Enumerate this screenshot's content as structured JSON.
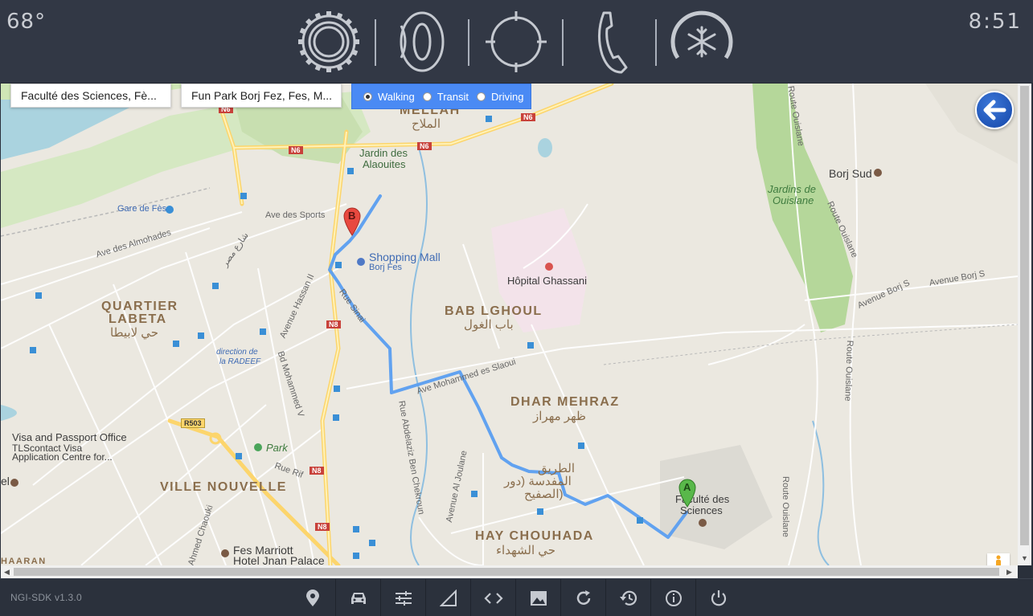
{
  "status": {
    "temperature": "68°",
    "time": "8:51"
  },
  "top_icons": [
    {
      "name": "settings-gear-icon"
    },
    {
      "name": "media-speaker-icon"
    },
    {
      "name": "navigation-compass-icon"
    },
    {
      "name": "phone-icon"
    },
    {
      "name": "climate-fan-icon"
    }
  ],
  "route": {
    "origin": "Faculté des Sciences, Fè...",
    "destination": "Fun Park Borj Fez, Fes, M...",
    "modes": [
      {
        "label": "Walking",
        "selected": true
      },
      {
        "label": "Transit",
        "selected": false
      },
      {
        "label": "Driving",
        "selected": false
      }
    ],
    "marker_a": "A",
    "marker_b": "B"
  },
  "map_labels": {
    "mellah": "MELLAH",
    "mellah_ar": "الملاح",
    "jardin_alaouites_1": "Jardin des",
    "jardin_alaouites_2": "Alaouites",
    "gare": "Gare de Fès",
    "ave_sports": "Ave des Sports",
    "ave_almohades": "Ave des Almohades",
    "shopping_mall": "Shopping Mall",
    "borj_fes": "Borj Fes",
    "hopital": "Hôpital Ghassani",
    "bab_lghoul": "BAB LGHOUL",
    "bab_lghoul_ar": "باب الغول",
    "quartier_1": "QUARTIER",
    "quartier_2": "LABETA",
    "quartier_ar": "حي لابيطا",
    "direction_1": "direction de",
    "direction_2": "la RADEEF",
    "avenue_hassan": "Avenue Hassan II",
    "rue_sinai": "Rue Sinai",
    "bd_mohammed": "Bd Mohammed V",
    "ave_slaoui": "Ave Mohammed es Slaoui",
    "dhar_mehraz": "DHAR MEHRAZ",
    "dhar_mehraz_ar": "ظهر مهراز",
    "rue_abdelaziz": "Rue Abdelaziz Ben Chekroun",
    "avenue_joulane": "Avenue Al Joulane",
    "tariq_1": "الطريق",
    "tariq_2": "المفدسة (دور",
    "tariq_3": "الصفيح)",
    "faculte_1": "Faculté des",
    "faculte_2": "Sciences",
    "hay_chouhada": "HAY CHOUHADA",
    "hay_chouhada_ar": "حي الشهداء",
    "visa_1": "Visa and Passport Office",
    "visa_2": "TLScontact Visa",
    "visa_3": "Application Centre for...",
    "park": "Park",
    "rue_rif": "Rue Rif",
    "ville_nouvelle": "VILLE NOUVELLE",
    "ahmed_chaouki": "Ahmed Chaouki",
    "fes_marriott_1": "Fes Marriott",
    "fes_marriott_2": "Hotel Jnan Palace",
    "borj_sud": "Borj Sud",
    "jardins_ouislane_1": "Jardins de",
    "jardins_ouislane_2": "Ouislane",
    "route_ouislane": "Route Ouislane",
    "avenue_borj": "Avenue Borj S",
    "avenue_borj_2": "Avenue Borj S",
    "sare_misr": "شارع مصر",
    "el_partial": "el",
    "ihaaran": "HAARAN",
    "n6": "N6",
    "n8": "N8",
    "r503": "R503"
  },
  "bottom": {
    "sdk_version": "NGI-SDK v1.3.0",
    "buttons": [
      {
        "name": "location-pin-icon"
      },
      {
        "name": "car-icon"
      },
      {
        "name": "sliders-icon"
      },
      {
        "name": "signal-icon"
      },
      {
        "name": "code-icon"
      },
      {
        "name": "image-icon"
      },
      {
        "name": "refresh-icon"
      },
      {
        "name": "history-icon"
      },
      {
        "name": "info-icon"
      },
      {
        "name": "power-icon"
      }
    ]
  },
  "colors": {
    "route": "#5a9ef0",
    "mode_bar": "#4a8af4",
    "topbar": "#323845",
    "map_bg": "#ebe8e0"
  }
}
